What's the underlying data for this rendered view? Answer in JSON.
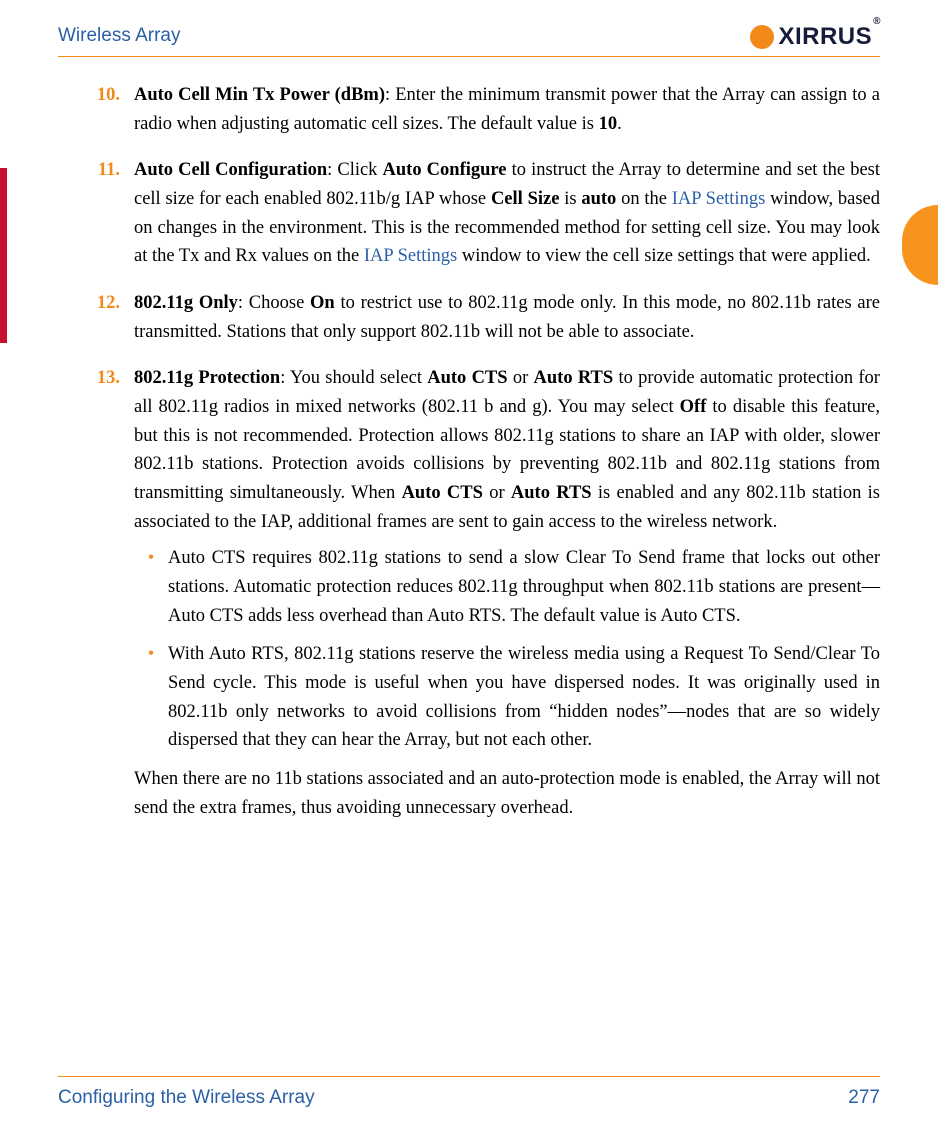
{
  "header": {
    "title": "Wireless Array",
    "logo_text": "XIRRUS",
    "logo_reg": "®"
  },
  "footer": {
    "section": "Configuring the Wireless Array",
    "page": "277"
  },
  "items": [
    {
      "num": "10.",
      "lead": "Auto Cell Min Tx Power (dBm)",
      "body_html": ": Enter the minimum transmit power that the Array can assign to a radio when adjusting automatic cell sizes. The default value is <b>10</b>."
    },
    {
      "num": "11.",
      "lead": "Auto Cell Configuration",
      "body_html": ": Click <b>Auto Configure</b> to instruct the Array to determine and set the best cell size for each enabled 802.11b/g IAP whose <b>Cell Size</b> is <b>auto</b> on the <span class=\"link\">IAP Settings</span> window, based on changes in the environment. This is the recommended method for setting cell size. You may look at the Tx and Rx values on the <span class=\"link\">IAP Settings</span> window to view the cell size settings that were applied."
    },
    {
      "num": "12.",
      "lead": "802.11g Only",
      "body_html": ": Choose <b>On</b> to restrict use to 802.11g mode only. In this mode, no 802.11b rates are transmitted. Stations that only support 802.11b will not be able to associate."
    },
    {
      "num": "13.",
      "lead": "802.11g Protection",
      "body_html": ": You should select <b>Auto CTS</b> or <b>Auto RTS</b> to provide automatic protection for all 802.11g radios in mixed networks (802.11 b&nbsp;and&nbsp;g). You may select <b>Off</b> to disable this feature, but this is not recommended. Protection allows 802.11g stations to share an IAP with older, slower 802.11b stations. Protection avoids collisions by preventing 802.11b and 802.11g stations from transmitting simultaneously. When <b>Auto CTS</b> or <b>Auto RTS</b> is enabled and any 802.11b station is associated to the IAP, additional frames are sent to gain access to the wireless network.",
      "bullets": [
        "Auto CTS requires 802.11g stations to send a slow Clear To Send frame that locks out other stations. Automatic protection reduces 802.11g throughput when 802.11b stations are present—Auto CTS adds less overhead than Auto RTS. The default value is Auto CTS.",
        "With Auto RTS, 802.11g stations reserve the wireless media using a Request To Send/Clear To Send cycle. This mode is useful when you have dispersed nodes. It was originally used in 802.11b only networks to avoid collisions from “hidden nodes”—nodes that are so widely dispersed that they can hear the Array, but not each other."
      ],
      "trailer": "When there are no 11b stations associated and an auto-protection mode is enabled, the Array will not send the extra frames, thus avoiding unnecessary overhead."
    }
  ]
}
